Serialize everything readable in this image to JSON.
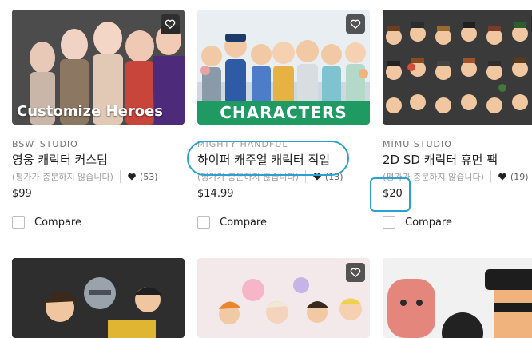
{
  "products": [
    {
      "thumb_title": "Customize Heroes",
      "publisher": "BSW_STUDIO",
      "name": "영웅 캐릭터 커스텀",
      "rating_text": "(평가가 충분하지 않습니다)",
      "likes": "(53)",
      "price": "$99",
      "compare_label": "Compare",
      "favorite_icon": "heart-outline-icon"
    },
    {
      "banner": "CHARACTERS",
      "publisher": "MIGHTY HANDFUL",
      "name": "하이퍼 캐주얼 캐릭터 직업",
      "rating_text": "(평가가 충분하지 않습니다)",
      "likes": "(13)",
      "price": "$14.99",
      "compare_label": "Compare",
      "favorite_icon": "heart-outline-icon"
    },
    {
      "publisher": "MIMU STUDIO",
      "name": "2D SD 캐릭터 휴먼 팩",
      "rating_text": "(평가가 충분하지 않습니다)",
      "likes": "(19)",
      "price": "$20",
      "compare_label": "Compare",
      "favorite_icon": "heart-outline-icon"
    }
  ],
  "colors": {
    "highlight": "#2aa1cf",
    "banner_green": "#1e9a62"
  }
}
